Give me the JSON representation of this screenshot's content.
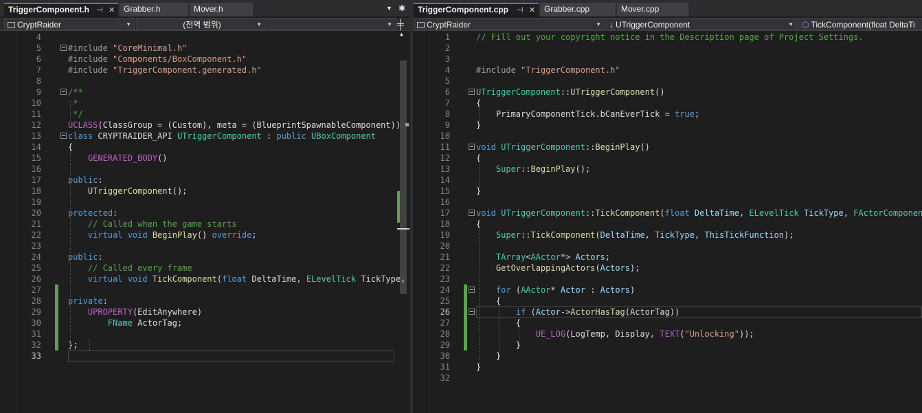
{
  "left": {
    "tabs": [
      {
        "label": "TriggerComponent.h",
        "active": true
      },
      {
        "label": "Grabber.h",
        "active": false
      },
      {
        "label": "Mover.h",
        "active": false
      }
    ],
    "nav": {
      "project": "CryptRaider",
      "scope": "(전역 범위)",
      "member": ""
    },
    "lines": [
      {
        "n": "4",
        "t": []
      },
      {
        "n": "5",
        "t": [
          [
            "m",
            "#include "
          ],
          [
            "s",
            "\"CoreMinimal.h\""
          ]
        ]
      },
      {
        "n": "6",
        "t": [
          [
            "m",
            "#include "
          ],
          [
            "s",
            "\"Components/BoxComponent.h\""
          ]
        ]
      },
      {
        "n": "7",
        "t": [
          [
            "m",
            "#include "
          ],
          [
            "s",
            "\"TriggerComponent.generated.h\""
          ]
        ]
      },
      {
        "n": "8",
        "t": []
      },
      {
        "n": "9",
        "t": [
          [
            "c",
            "/**"
          ]
        ]
      },
      {
        "n": "10",
        "t": [
          [
            "c",
            " *"
          ]
        ]
      },
      {
        "n": "11",
        "t": [
          [
            "c",
            " */"
          ]
        ]
      },
      {
        "n": "12",
        "t": [
          [
            "mac",
            "UCLASS"
          ],
          [
            "p",
            "(ClassGroup = (Custom), meta = (BlueprintSpawnableComponent))"
          ]
        ]
      },
      {
        "n": "13",
        "t": [
          [
            "k",
            "class "
          ],
          [
            "p",
            "CRYPTRAIDER_API "
          ],
          [
            "t",
            "UTriggerComponent"
          ],
          [
            "p",
            " : "
          ],
          [
            "k",
            "public "
          ],
          [
            "t",
            "UBoxComponent"
          ]
        ]
      },
      {
        "n": "14",
        "t": [
          [
            "p",
            "{"
          ]
        ]
      },
      {
        "n": "15",
        "t": [
          [
            "p",
            "    "
          ],
          [
            "mac",
            "GENERATED_BODY"
          ],
          [
            "p",
            "()"
          ]
        ]
      },
      {
        "n": "16",
        "t": []
      },
      {
        "n": "17",
        "t": [
          [
            "k",
            "public"
          ],
          [
            "p",
            ":"
          ]
        ]
      },
      {
        "n": "18",
        "t": [
          [
            "p",
            "    "
          ],
          [
            "f",
            "UTriggerComponent"
          ],
          [
            "p",
            "();"
          ]
        ]
      },
      {
        "n": "19",
        "t": []
      },
      {
        "n": "20",
        "t": [
          [
            "k",
            "protected"
          ],
          [
            "p",
            ":"
          ]
        ]
      },
      {
        "n": "21",
        "t": [
          [
            "p",
            "    "
          ],
          [
            "c",
            "// Called when the game starts"
          ]
        ]
      },
      {
        "n": "22",
        "t": [
          [
            "p",
            "    "
          ],
          [
            "k",
            "virtual void "
          ],
          [
            "f",
            "BeginPlay"
          ],
          [
            "p",
            "() "
          ],
          [
            "k",
            "override"
          ],
          [
            "p",
            ";"
          ]
        ]
      },
      {
        "n": "23",
        "t": []
      },
      {
        "n": "24",
        "t": [
          [
            "k",
            "public"
          ],
          [
            "p",
            ":"
          ]
        ]
      },
      {
        "n": "25",
        "t": [
          [
            "p",
            "    "
          ],
          [
            "c",
            "// Called every frame"
          ]
        ]
      },
      {
        "n": "26",
        "t": [
          [
            "p",
            "    "
          ],
          [
            "k",
            "virtual void "
          ],
          [
            "f",
            "TickComponent"
          ],
          [
            "p",
            "("
          ],
          [
            "k",
            "float "
          ],
          [
            "p",
            "DeltaTime, "
          ],
          [
            "t",
            "ELevelTick "
          ],
          [
            "p",
            "TickType,"
          ]
        ]
      },
      {
        "n": "27",
        "t": []
      },
      {
        "n": "28",
        "t": [
          [
            "k",
            "private"
          ],
          [
            "p",
            ":"
          ]
        ]
      },
      {
        "n": "29",
        "t": [
          [
            "p",
            "    "
          ],
          [
            "mac",
            "UPROPERTY"
          ],
          [
            "p",
            "(EditAnywhere)"
          ]
        ]
      },
      {
        "n": "30",
        "t": [
          [
            "p",
            "        "
          ],
          [
            "t",
            "FName "
          ],
          [
            "p",
            "ActorTag;"
          ]
        ]
      },
      {
        "n": "31",
        "t": []
      },
      {
        "n": "32",
        "t": [
          [
            "p",
            "};"
          ]
        ]
      },
      {
        "n": "33",
        "t": []
      }
    ]
  },
  "right": {
    "tabs": [
      {
        "label": "TriggerComponent.cpp",
        "active": true
      },
      {
        "label": "Grabber.cpp",
        "active": false
      },
      {
        "label": "Mover.cpp",
        "active": false
      }
    ],
    "nav": {
      "project": "CryptRaider",
      "scope": "UTriggerComponent",
      "member": "TickComponent(float DeltaTi"
    },
    "lines": [
      {
        "n": "1",
        "t": [
          [
            "c",
            "// Fill out your copyright notice in the Description page of Project Settings."
          ]
        ]
      },
      {
        "n": "2",
        "t": []
      },
      {
        "n": "3",
        "t": []
      },
      {
        "n": "4",
        "t": [
          [
            "m",
            "#include "
          ],
          [
            "s",
            "\"TriggerComponent.h\""
          ]
        ]
      },
      {
        "n": "5",
        "t": []
      },
      {
        "n": "6",
        "t": [
          [
            "t",
            "UTriggerComponent"
          ],
          [
            "p",
            "::"
          ],
          [
            "f",
            "UTriggerComponent"
          ],
          [
            "p",
            "()"
          ]
        ]
      },
      {
        "n": "7",
        "t": [
          [
            "p",
            "{"
          ]
        ]
      },
      {
        "n": "8",
        "t": [
          [
            "p",
            "    "
          ],
          [
            "mem",
            "PrimaryComponentTick"
          ],
          [
            "p",
            "."
          ],
          [
            "mem",
            "bCanEverTick"
          ],
          [
            "p",
            " = "
          ],
          [
            "k",
            "true"
          ],
          [
            "p",
            ";"
          ]
        ]
      },
      {
        "n": "9",
        "t": [
          [
            "p",
            "}"
          ]
        ]
      },
      {
        "n": "10",
        "t": []
      },
      {
        "n": "11",
        "t": [
          [
            "k",
            "void "
          ],
          [
            "t",
            "UTriggerComponent"
          ],
          [
            "p",
            "::"
          ],
          [
            "f",
            "BeginPlay"
          ],
          [
            "p",
            "()"
          ]
        ]
      },
      {
        "n": "12",
        "t": [
          [
            "p",
            "{"
          ]
        ]
      },
      {
        "n": "13",
        "t": [
          [
            "p",
            "    "
          ],
          [
            "t",
            "Super"
          ],
          [
            "p",
            "::"
          ],
          [
            "f",
            "BeginPlay"
          ],
          [
            "p",
            "();"
          ]
        ]
      },
      {
        "n": "14",
        "t": []
      },
      {
        "n": "15",
        "t": [
          [
            "p",
            "}"
          ]
        ]
      },
      {
        "n": "16",
        "t": []
      },
      {
        "n": "17",
        "t": [
          [
            "k",
            "void "
          ],
          [
            "t",
            "UTriggerComponent"
          ],
          [
            "p",
            "::"
          ],
          [
            "f",
            "TickComponent"
          ],
          [
            "p",
            "("
          ],
          [
            "k",
            "float "
          ],
          [
            "v",
            "DeltaTime"
          ],
          [
            "p",
            ", "
          ],
          [
            "t",
            "ELevelTick "
          ],
          [
            "v",
            "TickType"
          ],
          [
            "p",
            ", "
          ],
          [
            "t",
            "FActorComponentTi"
          ]
        ]
      },
      {
        "n": "18",
        "t": [
          [
            "p",
            "{"
          ]
        ]
      },
      {
        "n": "19",
        "t": [
          [
            "p",
            "    "
          ],
          [
            "t",
            "Super"
          ],
          [
            "p",
            "::"
          ],
          [
            "f",
            "TickComponent"
          ],
          [
            "p",
            "("
          ],
          [
            "v",
            "DeltaTime"
          ],
          [
            "p",
            ", "
          ],
          [
            "v",
            "TickType"
          ],
          [
            "p",
            ", "
          ],
          [
            "v",
            "ThisTickFunction"
          ],
          [
            "p",
            ");"
          ]
        ]
      },
      {
        "n": "20",
        "t": []
      },
      {
        "n": "21",
        "t": [
          [
            "p",
            "    "
          ],
          [
            "t",
            "TArray"
          ],
          [
            "p",
            "<"
          ],
          [
            "t",
            "AActor"
          ],
          [
            "p",
            "*> "
          ],
          [
            "v",
            "Actors"
          ],
          [
            "p",
            ";"
          ]
        ]
      },
      {
        "n": "22",
        "t": [
          [
            "p",
            "    "
          ],
          [
            "f",
            "GetOverlappingActors"
          ],
          [
            "p",
            "("
          ],
          [
            "v",
            "Actors"
          ],
          [
            "p",
            ");"
          ]
        ]
      },
      {
        "n": "23",
        "t": []
      },
      {
        "n": "24",
        "t": [
          [
            "p",
            "    "
          ],
          [
            "k",
            "for "
          ],
          [
            "p",
            "("
          ],
          [
            "t",
            "AActor"
          ],
          [
            "p",
            "* "
          ],
          [
            "v",
            "Actor"
          ],
          [
            "p",
            " : "
          ],
          [
            "v",
            "Actors"
          ],
          [
            "p",
            ")"
          ]
        ]
      },
      {
        "n": "25",
        "t": [
          [
            "p",
            "    {"
          ]
        ]
      },
      {
        "n": "26",
        "t": [
          [
            "p",
            "        "
          ],
          [
            "k",
            "if "
          ],
          [
            "p",
            "("
          ],
          [
            "v",
            "Actor"
          ],
          [
            "p",
            "->"
          ],
          [
            "f",
            "ActorHasTag"
          ],
          [
            "p",
            "("
          ],
          [
            "mem",
            "ActorTag"
          ],
          [
            "p",
            "))"
          ]
        ]
      },
      {
        "n": "27",
        "t": [
          [
            "p",
            "        {"
          ]
        ]
      },
      {
        "n": "28",
        "t": [
          [
            "p",
            "            "
          ],
          [
            "mac",
            "UE_LOG"
          ],
          [
            "p",
            "("
          ],
          [
            "mem",
            "LogTemp"
          ],
          [
            "p",
            ", "
          ],
          [
            "mem",
            "Display"
          ],
          [
            "p",
            ", "
          ],
          [
            "mac",
            "TEXT"
          ],
          [
            "p",
            "("
          ],
          [
            "s",
            "\"Unlocking\""
          ],
          [
            "p",
            "));"
          ]
        ]
      },
      {
        "n": "29",
        "t": [
          [
            "p",
            "        }"
          ]
        ]
      },
      {
        "n": "30",
        "t": [
          [
            "p",
            "    }"
          ]
        ]
      },
      {
        "n": "31",
        "t": [
          [
            "p",
            "}"
          ]
        ]
      },
      {
        "n": "32",
        "t": []
      }
    ]
  }
}
